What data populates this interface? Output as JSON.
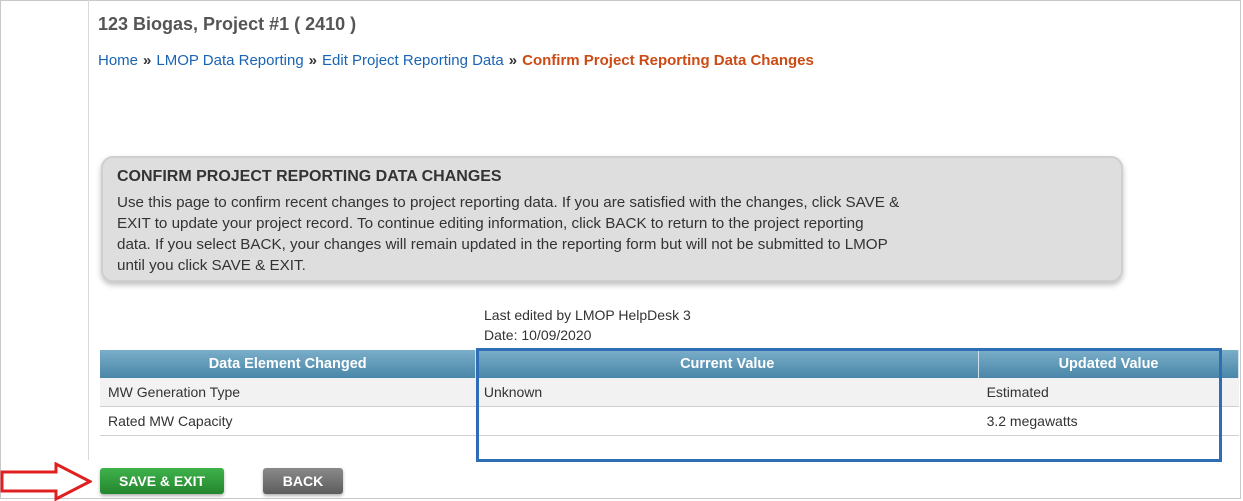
{
  "page": {
    "title": "123 Biogas, Project #1 ( 2410 )"
  },
  "breadcrumb": {
    "items": [
      "Home",
      "LMOP Data Reporting",
      "Edit Project Reporting Data"
    ],
    "separator": "»",
    "current": "Confirm Project Reporting Data Changes"
  },
  "info": {
    "heading": "CONFIRM PROJECT REPORTING DATA CHANGES",
    "lines": [
      "Use this page to confirm recent changes to project reporting data. If you are satisfied with the changes, click SAVE &",
      "EXIT to update your project record. To continue editing information, click BACK to return to the project reporting",
      "data. If you select BACK, your changes will remain updated in the reporting form but will not be submitted to LMOP",
      "until you click SAVE & EXIT."
    ]
  },
  "edit_meta": {
    "last_edited": "Last edited by LMOP HelpDesk 3",
    "date": "Date: 10/09/2020"
  },
  "table": {
    "headers": [
      "Data Element Changed",
      "Current Value",
      "Updated Value"
    ],
    "rows": [
      [
        "MW Generation Type",
        "Unknown",
        "Estimated"
      ],
      [
        "Rated MW Capacity",
        "",
        "3.2 megawatts"
      ]
    ]
  },
  "buttons": {
    "save_exit": "SAVE & EXIT",
    "back": "BACK"
  },
  "colors": {
    "link": "#1a64b4",
    "current_crumb": "#cc4a14",
    "table_header": "#4a86a8",
    "highlight": "#2f6db5",
    "arrow": "#e02020",
    "save_button": "#23862e"
  },
  "icons": {
    "pointer_arrow": "right-arrow-icon"
  }
}
